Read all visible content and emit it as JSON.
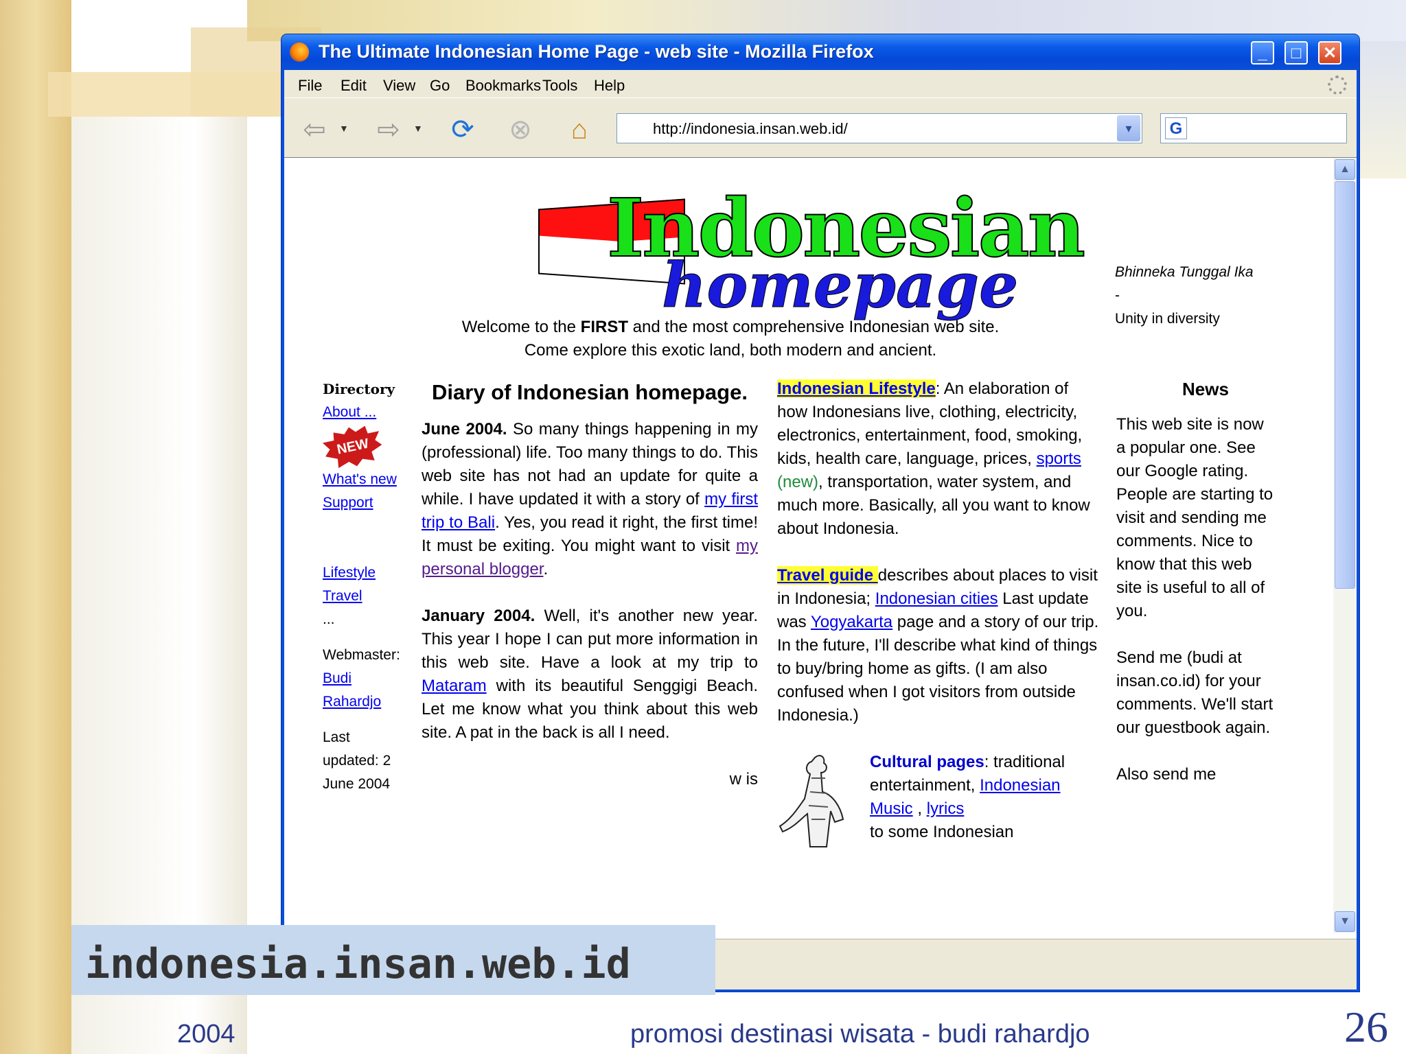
{
  "window": {
    "title": "The Ultimate Indonesian Home Page - web site - Mozilla Firefox"
  },
  "menu": [
    "File",
    "Edit",
    "View",
    "Go",
    "Bookmarks",
    "Tools",
    "Help"
  ],
  "toolbar": {
    "url": "http://indonesia.insan.web.id/"
  },
  "page": {
    "logo": {
      "line1": "Indonesian",
      "line2": "homepage"
    },
    "motto": {
      "line1": "Bhinneka Tunggal Ika",
      "line2": "-",
      "line3": "Unity in diversity"
    },
    "welcome": {
      "pre": "Welcome to the ",
      "bold": "FIRST",
      "post": " and the most comprehensive Indonesian web site.",
      "line2": "Come explore this exotic land, both modern and ancient."
    },
    "directory": {
      "heading": "Directory",
      "about": "About ...",
      "new_badge": "NEW",
      "whats_new": "What's new",
      "support": "Support",
      "lifestyle": "Lifestyle",
      "travel": "Travel",
      "ellipsis": "...",
      "webmaster_label": "Webmaster:",
      "webmaster_first": "Budi",
      "webmaster_last": "Rahardjo",
      "last_updated": "Last updated: 2 June 2004"
    },
    "diary": {
      "title": "Diary of Indonesian homepage.",
      "e1_date": "June 2004.",
      "e1_text1": " So many things happening in my (professional) life. Too many things to do. This web site has not had an update for quite a while. I have updated it with a story of ",
      "e1_link1": "my first trip to Bali",
      "e1_text2": ". Yes, you read it right, the first time! It must be exiting. You might want to visit ",
      "e1_link2": "my personal blogger",
      "e1_text3": ".",
      "e2_date": "January 2004.",
      "e2_text1": " Well, it's another new year. This year I hope I can put more information in this web site. Have a look at my trip to ",
      "e2_link": "Mataram",
      "e2_text2": " with its beautiful Senggigi Beach. Let me know what you think about this web site. A pat in the back is all I need.",
      "partial": "w is"
    },
    "lifestyle": {
      "link": "Indonesian Lifestyle",
      "text1": ": An elaboration of how Indonesians live, clothing, electricity, electronics, entertainment, food, smoking, kids, health care, language, prices, ",
      "sports": "sports",
      "new_tag": " (new)",
      "text2": ", transportation, water system, and much more. Basically, all you want to know about Indonesia."
    },
    "travel": {
      "link": "Travel guide ",
      "text1": "describes about places to visit in Indonesia; ",
      "cities": "Indonesian cities",
      "text2": " Last update was ",
      "yogya": "Yogyakarta",
      "text3": " page and a story of our trip. In the future, I'll describe what kind of things to buy/bring home as gifts. (I am also confused when I got visitors from outside Indonesia.)"
    },
    "cultural": {
      "heading": "Cultural pages",
      "text1": ": traditional entertainment, ",
      "music": "Indonesian Music",
      "sep": " , ",
      "lyrics": "lyrics",
      "partial": "to some Indonesian"
    },
    "news": {
      "heading": "News",
      "p1": "This web site is now a popular one. See our Google rating. People are starting to visit and sending me comments. Nice to know that this web site is useful to all of you.",
      "p2": "Send me (budi at insan.co.id) for your comments. We'll start our guestbook again.",
      "p3": "Also send me"
    }
  },
  "slide": {
    "site_label": "indonesia.insan.web.id",
    "year": "2004",
    "footer": "promosi destinasi wisata - budi rahardjo",
    "page_number": "26"
  }
}
